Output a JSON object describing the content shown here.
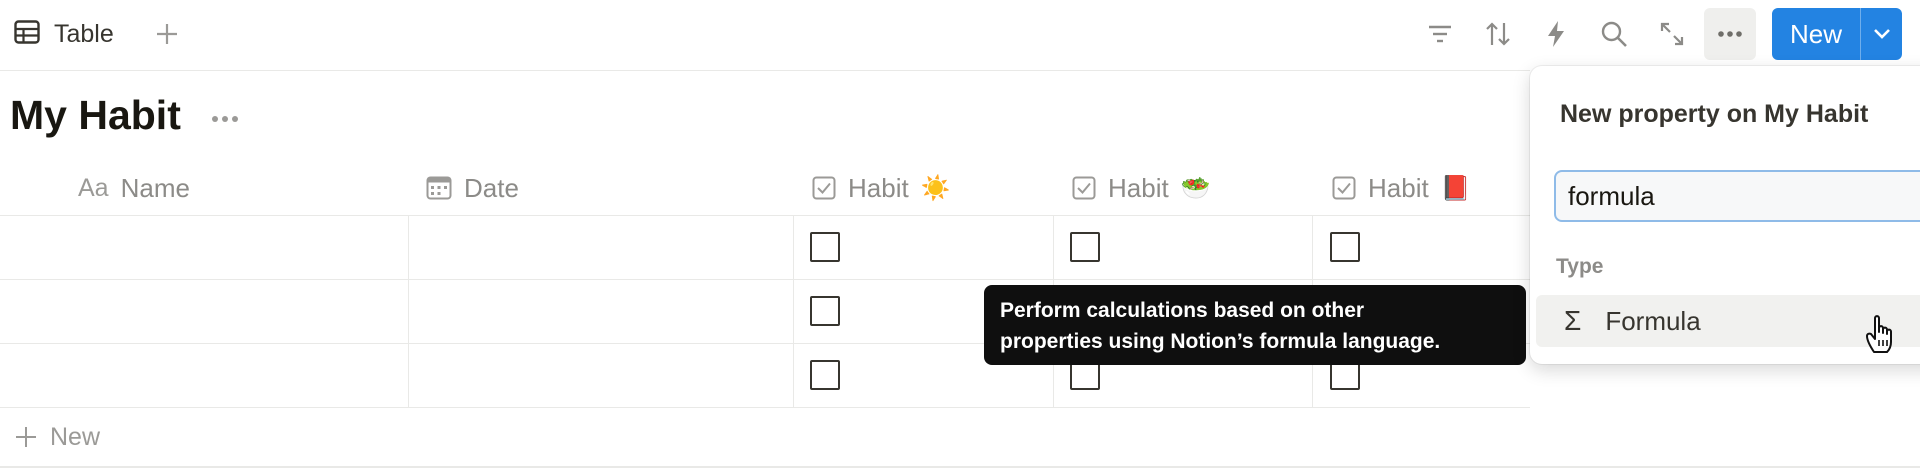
{
  "toolbar": {
    "view_tab_label": "Table",
    "new_button_label": "New",
    "icons": [
      "filter-icon",
      "sort-icon",
      "automation-icon",
      "search-icon",
      "expand-icon",
      "more-icon"
    ]
  },
  "database": {
    "title": "My Habit"
  },
  "table": {
    "columns": [
      {
        "label": "Name",
        "type_icon": "Aa"
      },
      {
        "label": "Date",
        "type_icon": "calendar-icon"
      },
      {
        "label": "Habit",
        "emoji": "☀️"
      },
      {
        "label": "Habit",
        "emoji": "🥗"
      },
      {
        "label": "Habit",
        "emoji": "📕"
      }
    ],
    "rows": [
      {
        "name": "",
        "date": "",
        "habit1": false,
        "habit2": false,
        "habit3": false
      },
      {
        "name": "",
        "date": "",
        "habit1": false,
        "habit2": false,
        "habit3": false
      },
      {
        "name": "",
        "date": "",
        "habit1": false,
        "habit2": false,
        "habit3": false
      }
    ],
    "new_row_label": "New"
  },
  "tooltip": {
    "line1": "Perform calculations based on other",
    "line2": "properties using Notion’s formula language."
  },
  "property_popup": {
    "title": "New property on My Habit",
    "search_value": "formula",
    "section_label": "Type",
    "result_label": "Formula",
    "result_icon": "Σ"
  },
  "colors": {
    "accent": "#2383e2",
    "tooltip_bg": "#0f0f0f",
    "grid_line": "#e9e9e7"
  }
}
